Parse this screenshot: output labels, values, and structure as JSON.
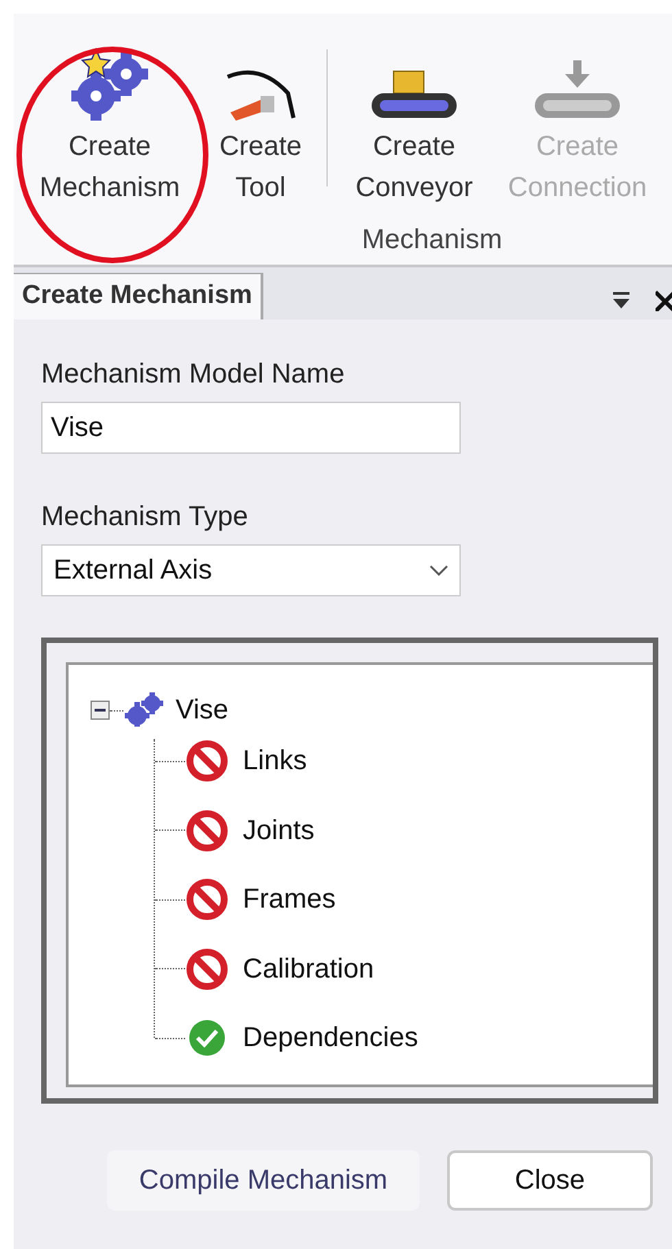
{
  "ribbon": {
    "buttons": [
      {
        "kind": "gears",
        "lines": [
          "Create",
          "Mechanism"
        ],
        "enabled": true,
        "circled": true
      },
      {
        "kind": "tool",
        "lines": [
          "Create",
          "Tool"
        ],
        "enabled": true,
        "circled": false
      },
      {
        "kind": "conveyor",
        "lines": [
          "Create",
          "Conveyor"
        ],
        "enabled": true,
        "circled": false
      },
      {
        "kind": "connection",
        "lines": [
          "Create",
          "Connection"
        ],
        "enabled": false,
        "circled": false
      }
    ],
    "group_label": "Mechanism"
  },
  "panel": {
    "tab": {
      "label": "Create Mechanism",
      "selected": true
    },
    "name_label": "Mechanism Model Name",
    "name_value": "Vise",
    "type_label": "Mechanism Type",
    "type_value": "External Axis",
    "tree": {
      "label": "Vise",
      "expanded": true,
      "children": [
        {
          "label": "Links",
          "kind": "error"
        },
        {
          "label": "Joints",
          "kind": "error"
        },
        {
          "label": "Frames",
          "kind": "error"
        },
        {
          "label": "Calibration",
          "kind": "error"
        },
        {
          "label": "Dependencies",
          "kind": "ok"
        }
      ]
    },
    "buttons": [
      {
        "label": "Compile Mechanism",
        "kind": "flat"
      },
      {
        "label": "Close",
        "kind": "bordered"
      }
    ]
  }
}
